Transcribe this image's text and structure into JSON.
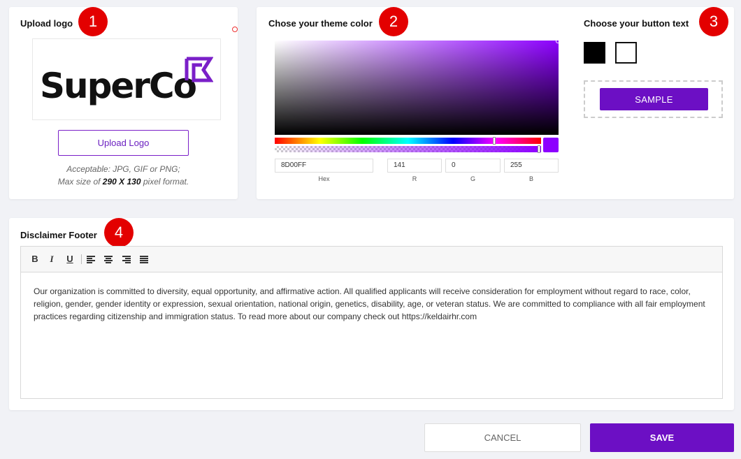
{
  "colors": {
    "accent": "#8D00FF",
    "button_purple": "#6C0FC4",
    "badge_red": "#E30000"
  },
  "logo_section": {
    "title": "Upload logo",
    "badge": "1",
    "logo_text": "SuperCo",
    "upload_button": "Upload Logo",
    "note_line1": "Acceptable: JPG, GIF or PNG;",
    "note_line2_prefix": "Max size of ",
    "note_line2_bold": "290 X 130",
    "note_line2_suffix": " pixel format."
  },
  "theme_section": {
    "title": "Chose your theme color",
    "badge": "2",
    "hex_value": "8D00FF",
    "hex_label": "Hex",
    "r_value": "141",
    "r_label": "R",
    "g_value": "0",
    "g_label": "G",
    "b_value": "255",
    "b_label": "B"
  },
  "button_text_section": {
    "title": "Choose your button text",
    "badge": "3",
    "swatches": [
      "black",
      "white"
    ],
    "sample_label": "SAMPLE"
  },
  "disclaimer_section": {
    "title": "Disclaimer Footer",
    "badge": "4",
    "toolbar": {
      "bold": "B",
      "italic": "I",
      "underline": "U"
    },
    "content": "Our organization is committed to diversity, equal opportunity, and affirmative action. All qualified applicants will receive consideration for employment without regard to race, color, religion, gender, gender identity or expression, sexual orientation, national origin, genetics, disability, age, or veteran status. We are committed to compliance with all fair employment practices regarding citizenship and immigration status. To read more about our company check out https://keldairhr.com"
  },
  "actions": {
    "cancel": "CANCEL",
    "save": "SAVE"
  }
}
